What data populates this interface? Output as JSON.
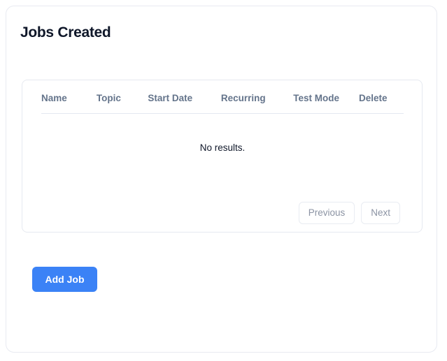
{
  "page": {
    "title": "Jobs Created"
  },
  "table": {
    "columns": [
      {
        "key": "name",
        "label": "Name"
      },
      {
        "key": "topic",
        "label": "Topic"
      },
      {
        "key": "start_date",
        "label": "Start Date"
      },
      {
        "key": "recurring",
        "label": "Recurring"
      },
      {
        "key": "test_mode",
        "label": "Test Mode"
      },
      {
        "key": "delete",
        "label": "Delete"
      }
    ],
    "rows": [],
    "empty_message": "No results."
  },
  "pagination": {
    "previous_label": "Previous",
    "next_label": "Next"
  },
  "actions": {
    "add_job_label": "Add Job"
  },
  "colors": {
    "accent": "#3b82f6",
    "title_text": "#0f1729",
    "header_text": "#64748b",
    "muted_text": "#8b93a3",
    "border": "#e6e9f0",
    "background": "#ffffff"
  }
}
